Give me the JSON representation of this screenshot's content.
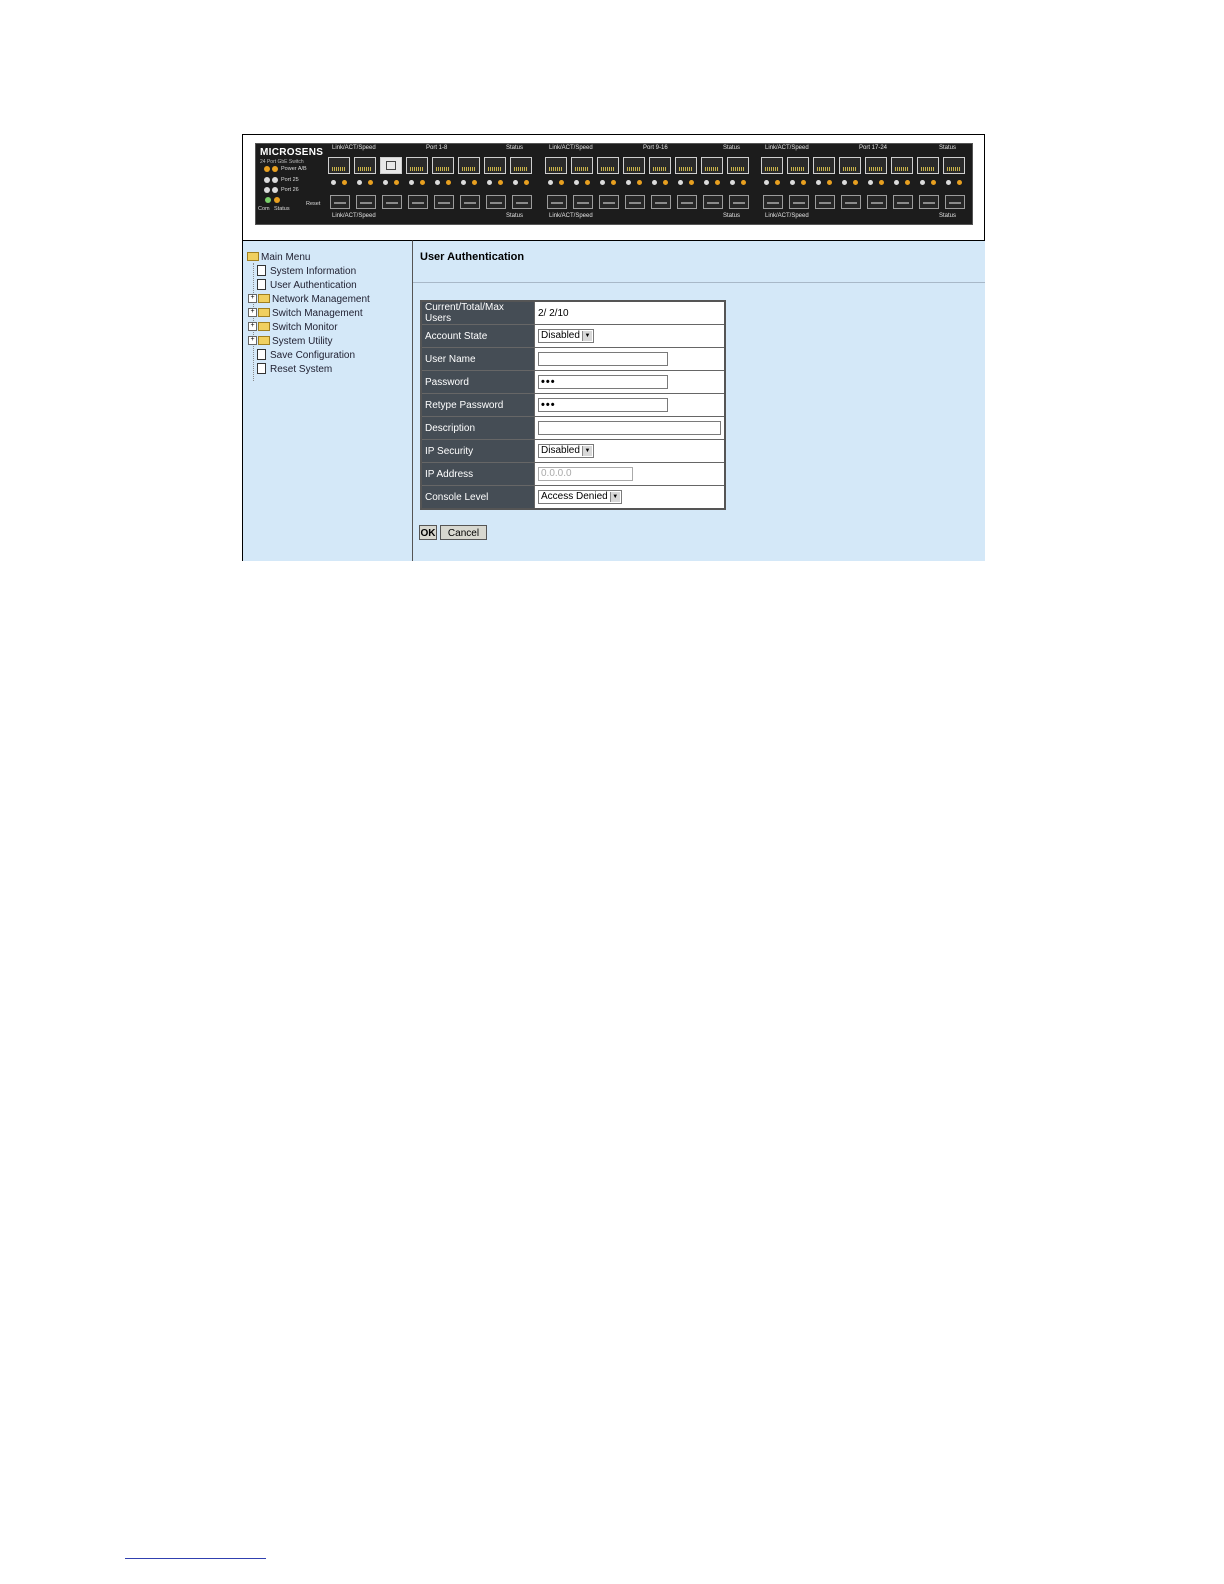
{
  "device": {
    "brand": "MICROSENS",
    "model": "24 Port GbE Switch",
    "power_label": "Power A/B",
    "port25_label": "Port 25",
    "port26_label": "Port 26",
    "com_label": "Com",
    "status_label": "Status",
    "reset_label": "Reset",
    "groups": [
      {
        "top_left": "Link/ACT/Speed",
        "top_mid": "Port 1-8",
        "top_right": "Status",
        "bottom_left": "Link/ACT/Speed",
        "bottom_right": "Status"
      },
      {
        "top_left": "Link/ACT/Speed",
        "top_mid": "Port 9-16",
        "top_right": "Status",
        "bottom_left": "Link/ACT/Speed",
        "bottom_right": "Status"
      },
      {
        "top_left": "Link/ACT/Speed",
        "top_mid": "Port 17-24",
        "top_right": "Status",
        "bottom_left": "Link/ACT/Speed",
        "bottom_right": "Status"
      }
    ]
  },
  "sidebar": {
    "root": "Main Menu",
    "items": [
      {
        "label": "System Information",
        "type": "page"
      },
      {
        "label": "User Authentication",
        "type": "page"
      },
      {
        "label": "Network Management",
        "type": "folder"
      },
      {
        "label": "Switch Management",
        "type": "folder"
      },
      {
        "label": "Switch Monitor",
        "type": "folder"
      },
      {
        "label": "System Utility",
        "type": "folder"
      },
      {
        "label": "Save Configuration",
        "type": "page"
      },
      {
        "label": "Reset System",
        "type": "page"
      }
    ]
  },
  "main": {
    "title": "User Authentication",
    "fields": {
      "users": {
        "label": "Current/Total/Max Users",
        "value": "2/ 2/10"
      },
      "account_state": {
        "label": "Account State",
        "value": "Disabled"
      },
      "user_name": {
        "label": "User Name",
        "value": ""
      },
      "password": {
        "label": "Password",
        "value": "•••"
      },
      "retype_password": {
        "label": "Retype Password",
        "value": "•••"
      },
      "description": {
        "label": "Description",
        "value": ""
      },
      "ip_security": {
        "label": "IP Security",
        "value": "Disabled"
      },
      "ip_address": {
        "label": "IP Address",
        "value": "0.0.0.0"
      },
      "console_level": {
        "label": "Console Level",
        "value": "Access Denied"
      }
    },
    "ok_label": "OK",
    "cancel_label": "Cancel"
  },
  "colors": {
    "panel_background": "#d4e8f8",
    "label_cell": "#454d55",
    "device_background": "#1c1c1c"
  }
}
